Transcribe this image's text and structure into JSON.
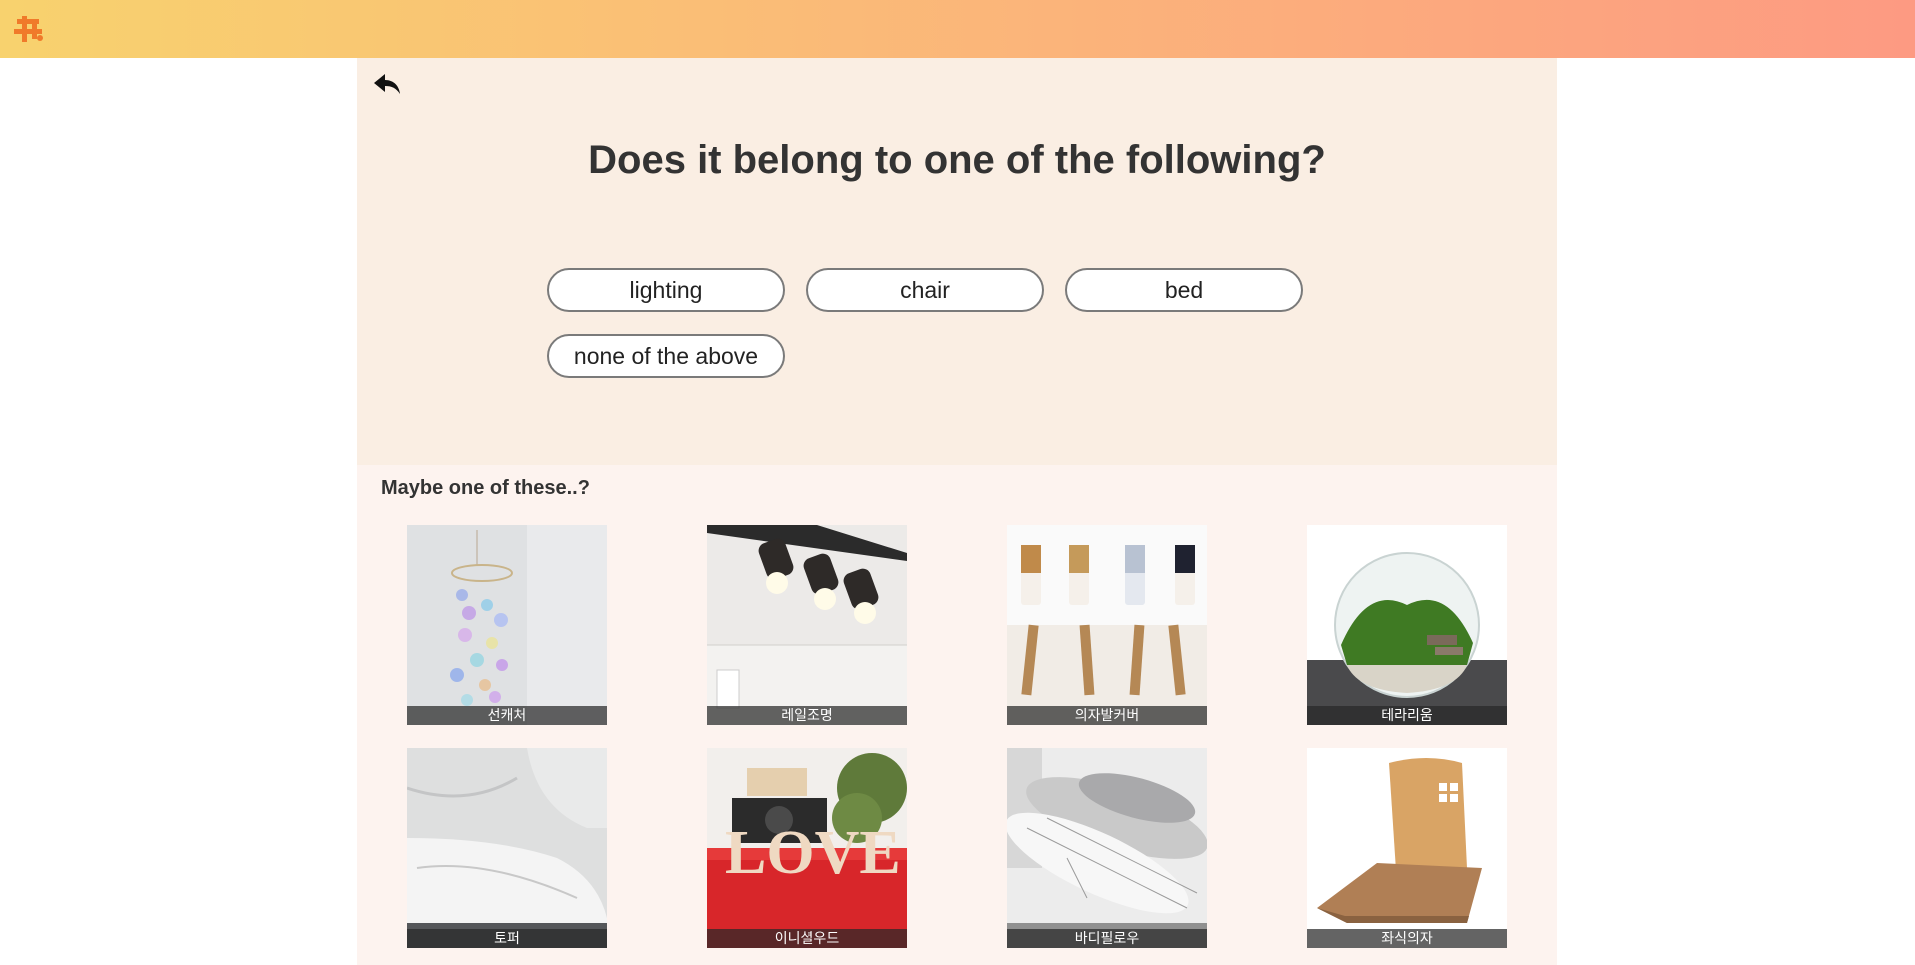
{
  "header": {
    "logo_icon": "puzzle-logo-icon",
    "gradient": [
      "#f8d26e",
      "#fd9a82"
    ],
    "accent": "#f07a2a"
  },
  "question": {
    "back_icon": "reply-arrow-icon",
    "title": "Does it belong to one of the following?",
    "options": [
      "lighting",
      "chair",
      "bed",
      "none of the above"
    ]
  },
  "suggestions": {
    "heading": "Maybe one of these..?",
    "items": [
      {
        "label": "선캐처"
      },
      {
        "label": "레일조명"
      },
      {
        "label": "의자발커버"
      },
      {
        "label": "테라리움"
      },
      {
        "label": "토퍼"
      },
      {
        "label": "이니셜우드"
      },
      {
        "label": "바디필로우"
      },
      {
        "label": "좌식의자"
      }
    ]
  }
}
